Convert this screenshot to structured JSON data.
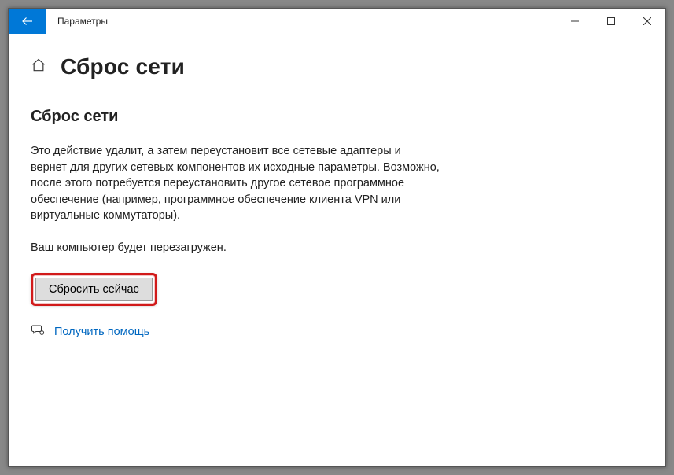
{
  "window": {
    "app_title": "Параметры"
  },
  "page": {
    "title": "Сброс сети",
    "section_title": "Сброс сети",
    "description": "Это действие удалит, а затем переустановит все сетевые адаптеры и вернет для других сетевых компонентов их исходные параметры. Возможно, после этого потребуется переустановить другое сетевое программное обеспечение (например, программное обеспечение клиента VPN или виртуальные коммутаторы).",
    "restart_notice": "Ваш компьютер будет перезагружен.",
    "reset_button_label": "Сбросить сейчас",
    "help_link_label": "Получить помощь"
  }
}
